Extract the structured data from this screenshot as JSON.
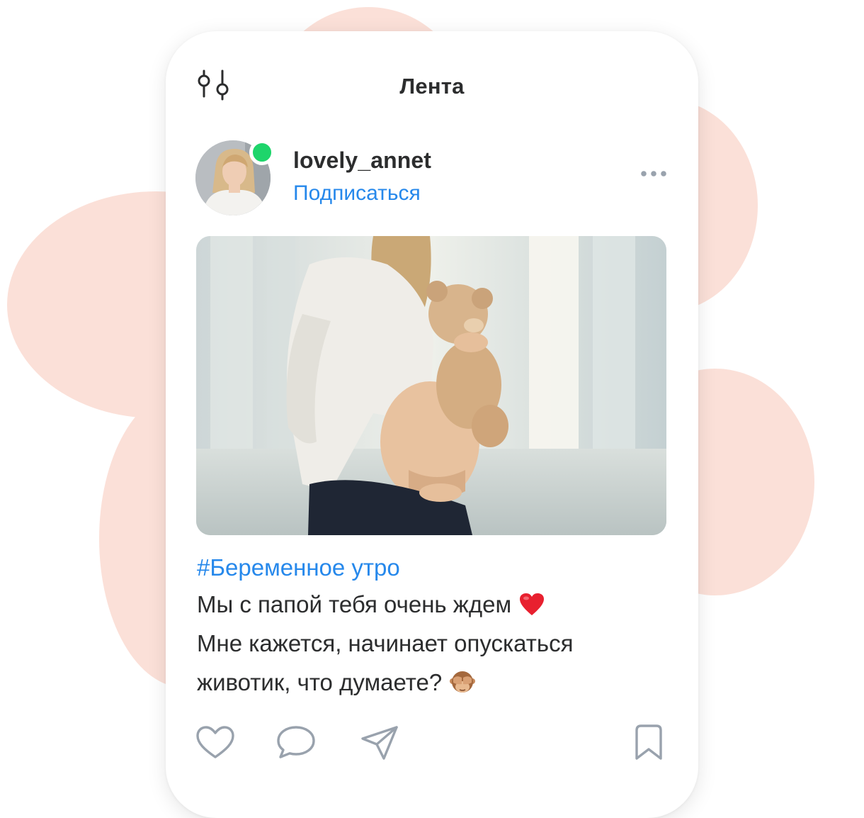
{
  "header": {
    "title": "Лента",
    "filter_icon": "filter-sliders-icon"
  },
  "post": {
    "author": {
      "username": "lovely_annet",
      "subscribe_label": "Подписаться",
      "online": true,
      "online_color": "#1ed56b"
    },
    "more_icon": "more-horizontal-icon",
    "image_alt": "pregnant woman holding a teddy bear by a window",
    "hashtag": "#Беременное утро",
    "text_lines": [
      "Мы с папой тебя очень ждем",
      "Мне кажется, начинает опускаться",
      "животик, что думаете?"
    ],
    "emojis": [
      "red-heart-emoji",
      "see-no-evil-monkey-emoji"
    ],
    "actions": [
      "heart-icon",
      "comment-icon",
      "share-icon",
      "bookmark-icon"
    ]
  },
  "colors": {
    "accent": "#2688eb",
    "text": "#2c2d2e",
    "icon": "#99a2ad",
    "blob": "#fbe0d8"
  }
}
